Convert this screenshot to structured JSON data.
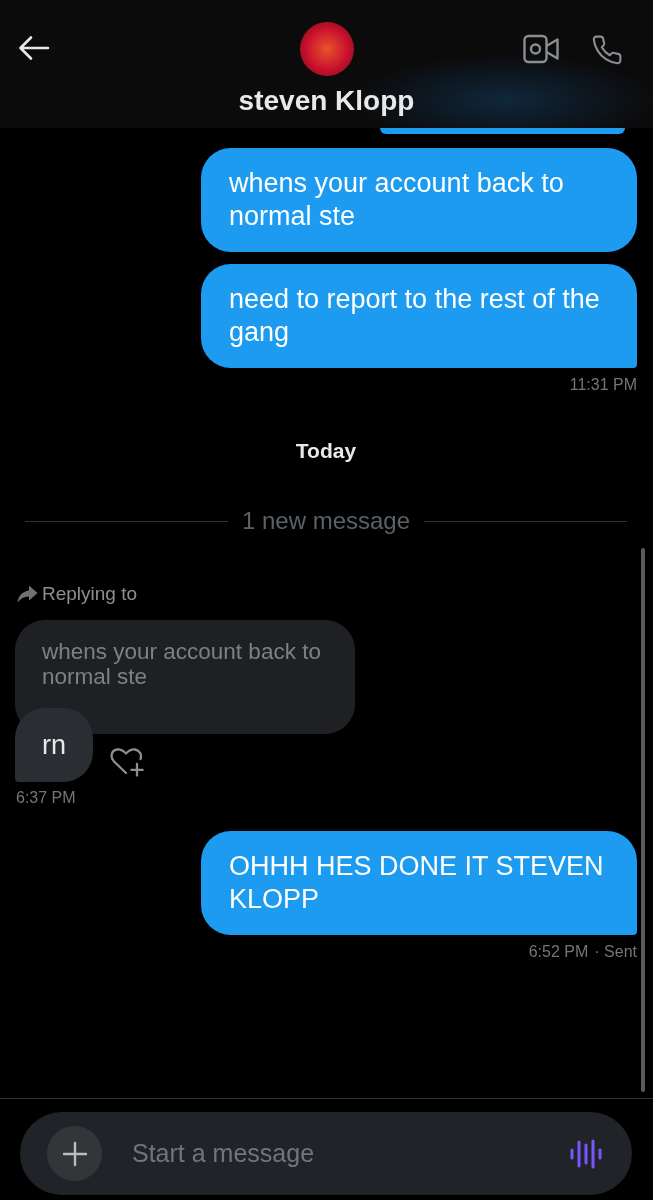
{
  "header": {
    "title": "steven Klopp"
  },
  "messages": [
    {
      "kind": "outgoing",
      "text": "whens your account back to normal ste"
    },
    {
      "kind": "outgoing",
      "text": "need to report to the rest of the gang",
      "time": "11:31 PM"
    },
    {
      "kind": "date",
      "text": "Today"
    },
    {
      "kind": "new_divider",
      "text": "1 new message"
    },
    {
      "kind": "incoming",
      "reply_label": "Replying to",
      "quoted": "whens your account back to normal ste",
      "text": "rn",
      "time": "6:37 PM"
    },
    {
      "kind": "outgoing",
      "text": "OHHH HES DONE IT STEVEN KLOPP",
      "time": "6:52 PM",
      "status": "· Sent"
    }
  ],
  "composer": {
    "placeholder": "Start a message"
  }
}
